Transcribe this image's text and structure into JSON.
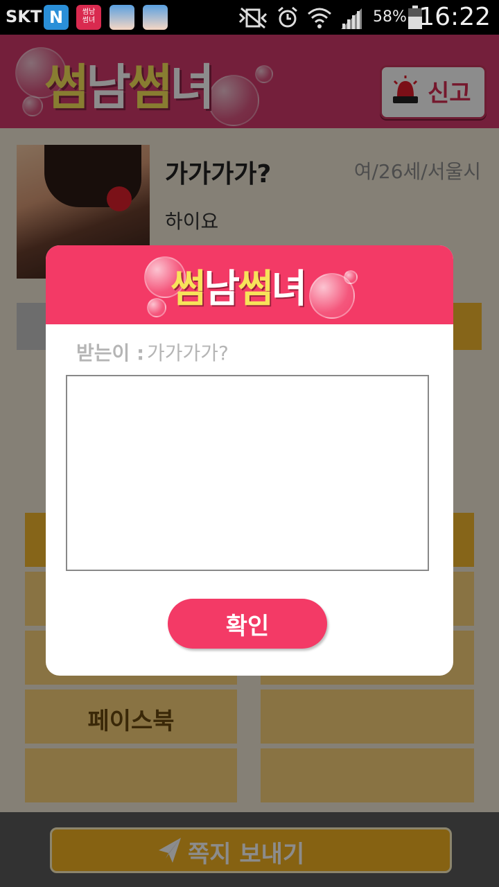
{
  "statusbar": {
    "carrier": "SKT",
    "battery": "58%",
    "time": "16:22",
    "app_icon_label": "썸남\n썸녀"
  },
  "header": {
    "logo_part1": "썸",
    "logo_part2": "남",
    "logo_part3": "썸",
    "logo_part4": "녀",
    "report_button": "신고"
  },
  "profile": {
    "nickname": "가가가가?",
    "meta": "여/26세/서울시",
    "status_message": "하이요"
  },
  "tiles": {
    "facebook": "페이스북"
  },
  "bottom": {
    "send_message_button": "쪽지 보내기"
  },
  "dialog": {
    "logo_part1": "썸",
    "logo_part2": "남",
    "logo_part3": "썸",
    "logo_part4": "녀",
    "recipient_label": "받는이 :",
    "recipient_name": "가가가가?",
    "message_value": "",
    "confirm_button": "확인"
  },
  "colors": {
    "header_pink": "#d43a6c",
    "dialog_pink": "#f33a66",
    "tile_yellow": "#f9d27a",
    "tile_yellow_strong": "#f5b92e"
  }
}
